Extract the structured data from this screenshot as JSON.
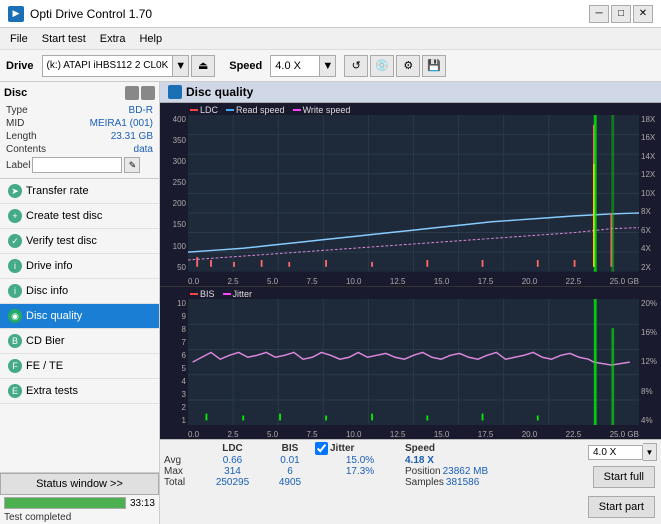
{
  "app": {
    "title": "Opti Drive Control 1.70",
    "icon": "ODC"
  },
  "title_buttons": {
    "minimize": "─",
    "maximize": "□",
    "close": "✕"
  },
  "menu": {
    "items": [
      "File",
      "Start test",
      "Extra",
      "Help"
    ]
  },
  "drive_bar": {
    "label": "Drive",
    "drive_value": "(k:) ATAPI iHBS112  2 CL0K",
    "speed_label": "Speed",
    "speed_value": "4.0 X"
  },
  "disc": {
    "label": "Disc",
    "fields": [
      {
        "key": "Type",
        "value": "BD-R"
      },
      {
        "key": "MID",
        "value": "MEIRA1 (001)"
      },
      {
        "key": "Length",
        "value": "23.31 GB"
      },
      {
        "key": "Contents",
        "value": "data"
      }
    ],
    "label_field": "Label"
  },
  "nav": {
    "items": [
      {
        "id": "transfer-rate",
        "label": "Transfer rate",
        "active": false
      },
      {
        "id": "create-test",
        "label": "Create test disc",
        "active": false
      },
      {
        "id": "verify-test",
        "label": "Verify test disc",
        "active": false
      },
      {
        "id": "drive-info",
        "label": "Drive info",
        "active": false
      },
      {
        "id": "disc-info",
        "label": "Disc info",
        "active": false
      },
      {
        "id": "disc-quality",
        "label": "Disc quality",
        "active": true
      },
      {
        "id": "cd-bier",
        "label": "CD Bier",
        "active": false
      },
      {
        "id": "fe-te",
        "label": "FE / TE",
        "active": false
      },
      {
        "id": "extra-tests",
        "label": "Extra tests",
        "active": false
      }
    ]
  },
  "status": {
    "window_btn": "Status window >>",
    "progress": 100,
    "status_text": "Test completed",
    "time": "33:13"
  },
  "quality_header": "Disc quality",
  "chart1": {
    "title": "LDC/Read/Write",
    "legend": [
      {
        "label": "LDC",
        "color": "#ff4444"
      },
      {
        "label": "Read speed",
        "color": "#44aaff"
      },
      {
        "label": "Write speed",
        "color": "#ff44ff"
      }
    ],
    "y_labels_left": [
      "400",
      "350",
      "300",
      "250",
      "200",
      "150",
      "100",
      "50"
    ],
    "y_labels_right": [
      "18X",
      "16X",
      "14X",
      "12X",
      "10X",
      "8X",
      "6X",
      "4X",
      "2X"
    ],
    "x_labels": [
      "0.0",
      "2.5",
      "5.0",
      "7.5",
      "10.0",
      "12.5",
      "15.0",
      "17.5",
      "20.0",
      "22.5",
      "25.0 GB"
    ]
  },
  "chart2": {
    "title": "BIS/Jitter",
    "legend": [
      {
        "label": "BIS",
        "color": "#ff4444"
      },
      {
        "label": "Jitter",
        "color": "#ff44ff"
      }
    ],
    "y_labels_left": [
      "10",
      "9",
      "8",
      "7",
      "6",
      "5",
      "4",
      "3",
      "2",
      "1"
    ],
    "y_labels_right": [
      "20%",
      "16%",
      "12%",
      "8%",
      "4%"
    ],
    "x_labels": [
      "0.0",
      "2.5",
      "5.0",
      "7.5",
      "10.0",
      "12.5",
      "15.0",
      "17.5",
      "20.0",
      "22.5",
      "25.0 GB"
    ]
  },
  "stats": {
    "headers": [
      "",
      "LDC",
      "BIS",
      "",
      "Jitter",
      "Speed"
    ],
    "jitter_checked": true,
    "rows": [
      {
        "label": "Avg",
        "ldc": "0.66",
        "bis": "0.01",
        "jitter": "15.0%",
        "speed": "4.18 X"
      },
      {
        "label": "Max",
        "ldc": "314",
        "bis": "6",
        "jitter": "17.3%",
        "position": "23862 MB"
      },
      {
        "label": "Total",
        "ldc": "250295",
        "bis": "4905",
        "jitter": "",
        "samples": "381586"
      }
    ],
    "speed_selector": "4.0 X",
    "start_full": "Start full",
    "start_part": "Start part",
    "position_label": "Position",
    "samples_label": "Samples",
    "speed_result_label": "Speed",
    "speed_result": "4.18 X"
  }
}
